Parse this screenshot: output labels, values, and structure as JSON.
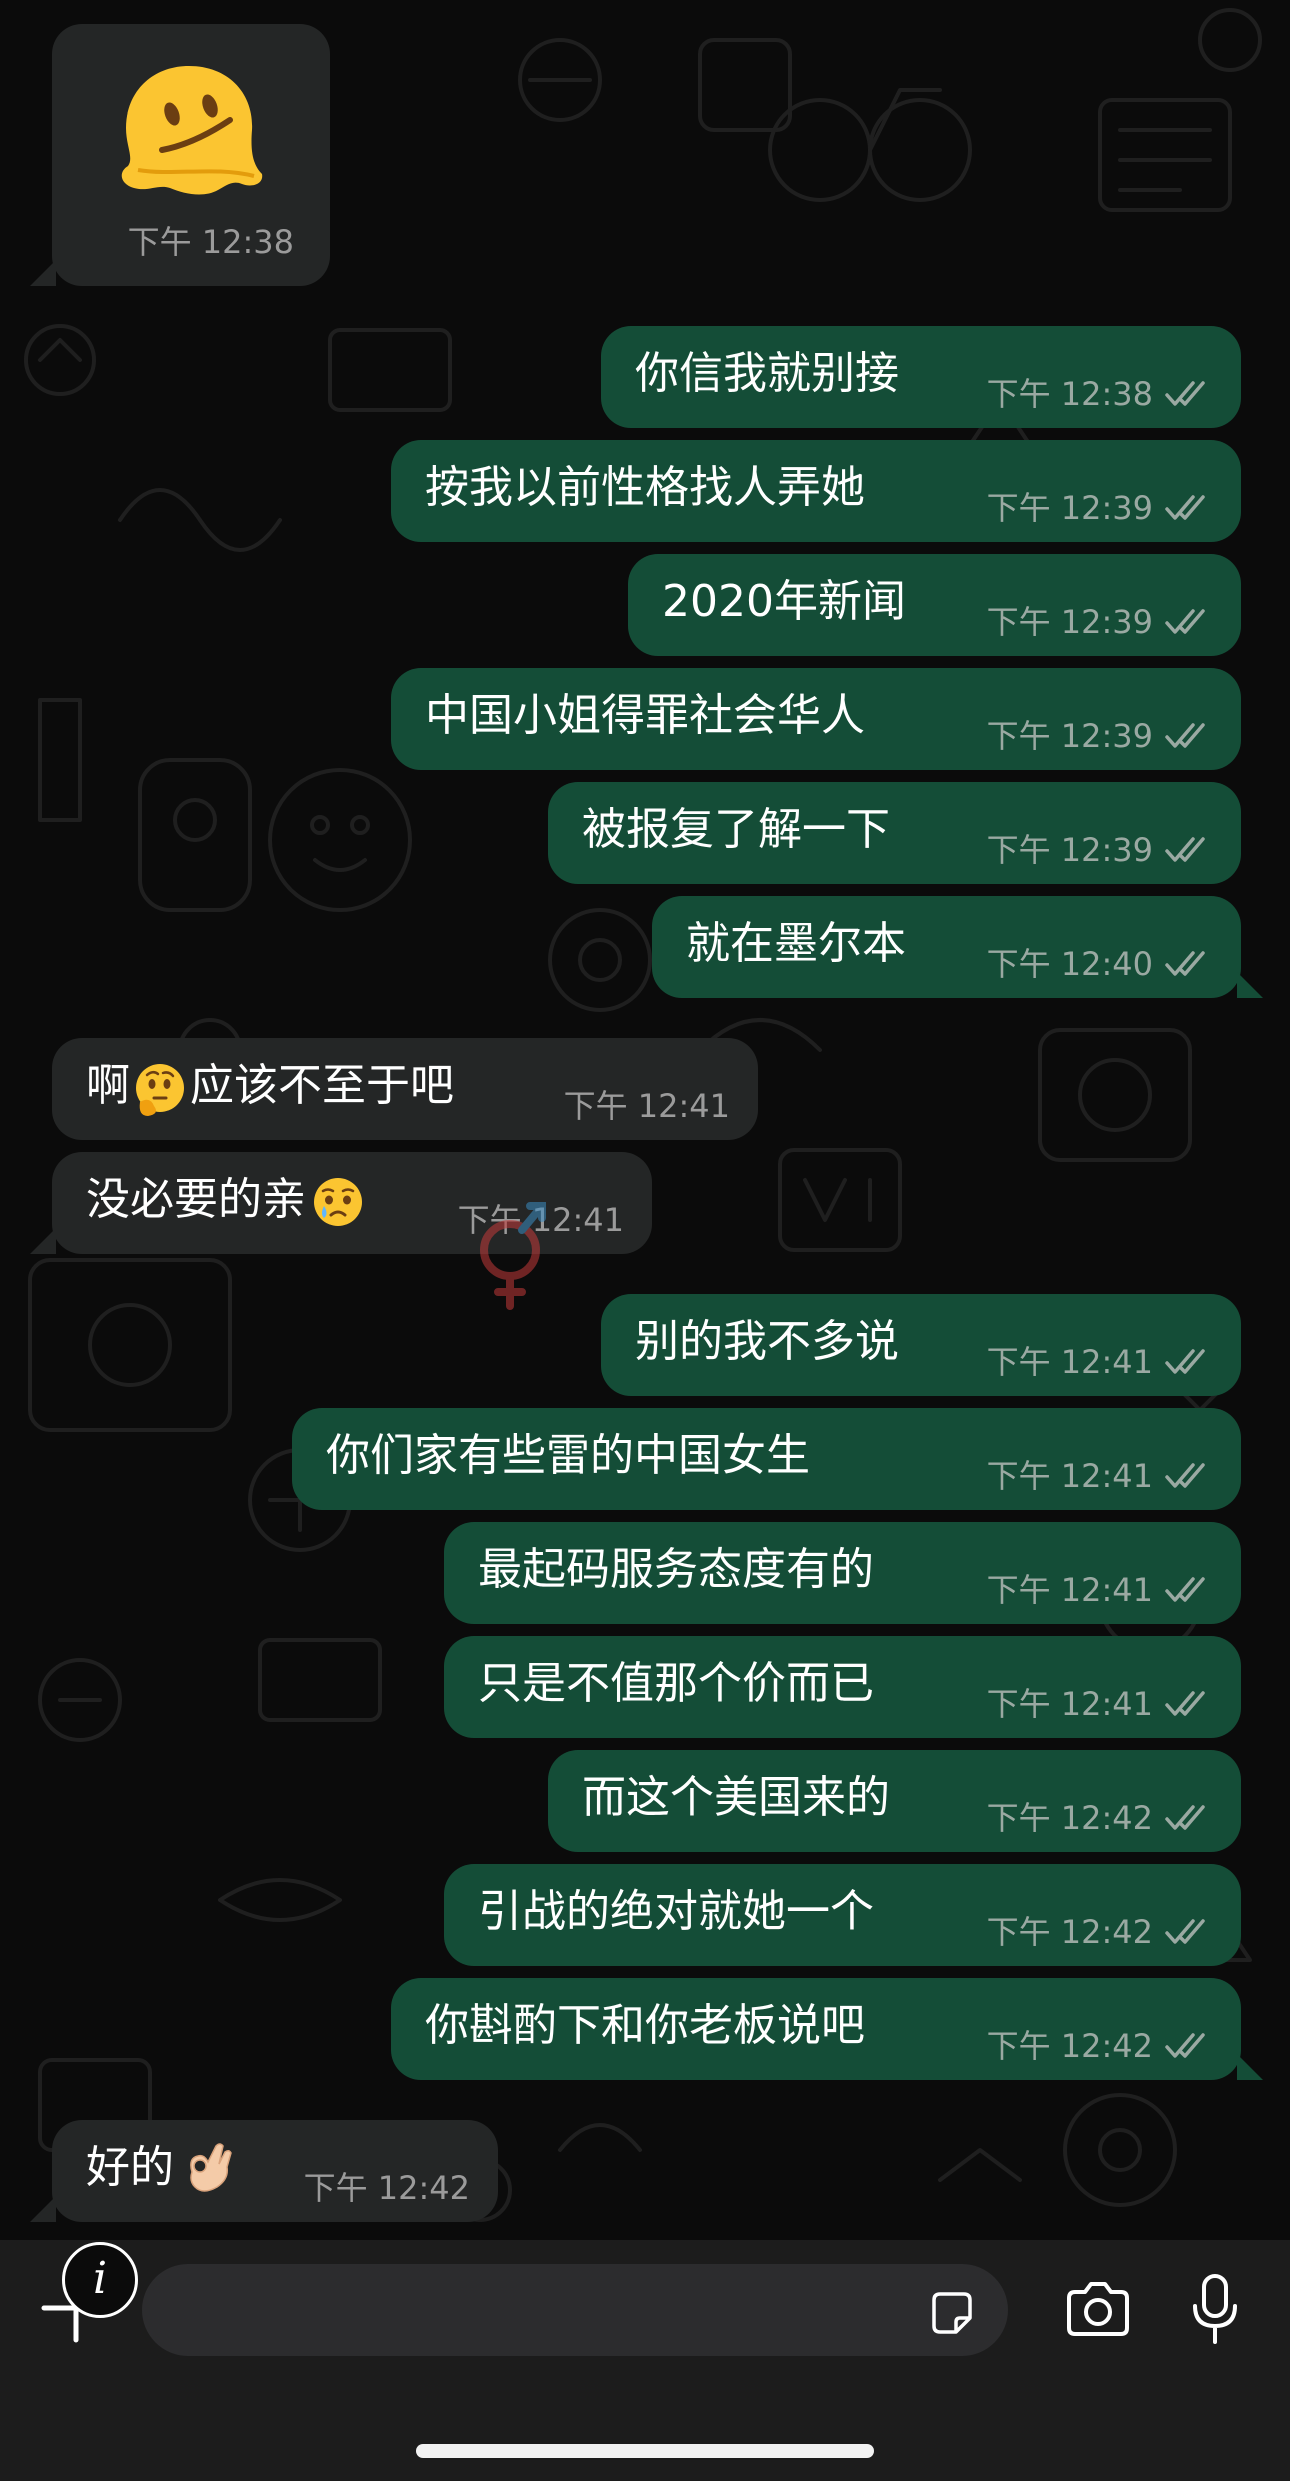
{
  "colors": {
    "outgoing_bubble": "#144d37",
    "incoming_bubble": "#242626",
    "read_ticks": "#9aa9a2",
    "background": "#0b0b0b"
  },
  "messages": [
    {
      "dir": "in",
      "emoji": "melting-face",
      "time": "下午 12:38"
    },
    {
      "dir": "out",
      "text": "你信我就别接",
      "time": "下午 12:38"
    },
    {
      "dir": "out",
      "text": "按我以前性格找人弄她",
      "time": "下午 12:39"
    },
    {
      "dir": "out",
      "text": "2020年新闻",
      "time": "下午 12:39"
    },
    {
      "dir": "out",
      "text": "中国小姐得罪社会华人",
      "time": "下午 12:39"
    },
    {
      "dir": "out",
      "text": "被报复了解一下",
      "time": "下午 12:39"
    },
    {
      "dir": "out",
      "text": "就在墨尔本",
      "time": "下午 12:40"
    },
    {
      "dir": "in",
      "text_a": "啊",
      "emoji": "thinking-face",
      "text_b": "应该不至于吧",
      "time": "下午 12:41"
    },
    {
      "dir": "in",
      "text_a": "没必要的亲",
      "emoji": "holding-back-tears-face",
      "time": "下午 12:41"
    },
    {
      "dir": "out",
      "text": "别的我不多说",
      "time": "下午 12:41"
    },
    {
      "dir": "out",
      "text": "你们家有些雷的中国女生",
      "time": "下午 12:41"
    },
    {
      "dir": "out",
      "text": "最起码服务态度有的",
      "time": "下午 12:41"
    },
    {
      "dir": "out",
      "text": "只是不值那个价而已",
      "time": "下午 12:41"
    },
    {
      "dir": "out",
      "text": "而这个美国来的",
      "time": "下午 12:42"
    },
    {
      "dir": "out",
      "text": "引战的绝对就她一个",
      "time": "下午 12:42"
    },
    {
      "dir": "out",
      "text": "你斟酌下和你老板说吧",
      "time": "下午 12:42"
    },
    {
      "dir": "in",
      "text_a": "好的",
      "emoji": "ok-hand",
      "time": "下午 12:42"
    }
  ],
  "input_bar": {
    "info_label": "i",
    "placeholder": "",
    "icons": [
      "plus-icon",
      "info-icon",
      "sticker-icon",
      "camera-icon",
      "microphone-icon"
    ]
  }
}
